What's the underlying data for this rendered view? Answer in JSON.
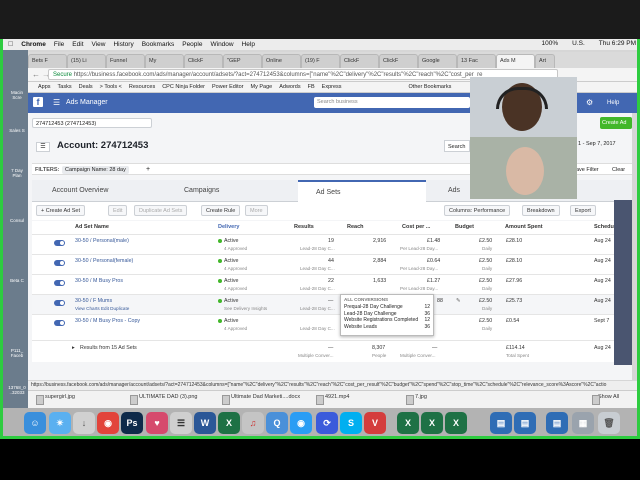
{
  "os": {
    "menu": [
      "Chrome",
      "File",
      "Edit",
      "View",
      "History",
      "Bookmarks",
      "People",
      "Window",
      "Help"
    ],
    "status_right": [
      "100%",
      "U.S.",
      "Thu 6:29 PM"
    ]
  },
  "browser": {
    "tabs": [
      "Bets F",
      "(15) Li",
      "Funnel",
      "My",
      "ClickF",
      "\"GEP",
      "Online",
      "(19) F",
      "ClickF",
      "ClickF",
      "Google",
      "13 Fac",
      "Ads M",
      "Art"
    ],
    "secure_label": "Secure",
    "url": "https://business.facebook.com/ads/manager/account/adsets/?act=274712453&columns=[\"name\"%2C\"delivery\"%2C\"results\"%2C\"reach\"%2C\"cost_per_re",
    "bookmarks": [
      "Apps",
      "Tasks",
      "Deals",
      "> Tools <",
      "Resources",
      "CPC Ninja Folder",
      "Power Editor",
      "My Page",
      "Adwords",
      "FB",
      "Express",
      "Other Bookmarks"
    ],
    "status_url": "https://business.facebook.com/ads/manager/account/adsets/?act=274712453&columns=[\"name\"%2C\"delivery\"%2C\"results\"%2C\"reach\"%2C\"cost_per_result\"%2C\"budget\"%2C\"spend\"%2C\"stop_time\"%2C\"schedule\"%2C\"relevance_score%3Ascore\"%2C\"actio"
  },
  "fb": {
    "app_title": "Ads Manager",
    "search_placeholder": "Search business",
    "account_selector": "274712453 (274712453)",
    "account_title": "Account: 274712453",
    "search_btn": "Search",
    "date_range": "1 - Sep 7, 2017",
    "filters_label": "FILTERS:",
    "filter_chip": "Campaign Name: 28 day",
    "filter_add": "+",
    "save_filter": "ave Filter",
    "clear": "Clear",
    "create_ad": "Create Ad",
    "help": "Help",
    "tabs": {
      "overview": "Account Overview",
      "campaigns": "Campaigns",
      "adsets": "Ad Sets",
      "ads": "Ads"
    },
    "toolbar": {
      "create": "Create Ad Set",
      "edit": "Edit",
      "duplicate": "Duplicate Ad Sets",
      "rule": "Create Rule",
      "more": "More",
      "columns": "Columns: Performance",
      "breakdown": "Breakdown",
      "export": "Export"
    },
    "headers": {
      "name": "Ad Set Name",
      "delivery": "Delivery",
      "results": "Results",
      "reach": "Reach",
      "cpr": "Cost per ...",
      "budget": "Budget",
      "spent": "Amount Spent",
      "schedule": "Schedu"
    },
    "rows": [
      {
        "name": "30-50 / Personal(male)",
        "delivery": "Active",
        "delivery_sub": "4 Approved",
        "results": "19",
        "results_sub": "Lead-28 Day C...",
        "reach": "2,916",
        "cpr": "£1.48",
        "cpr_sub": "Per Lead-28 Day...",
        "budget": "£2.50",
        "budget_sub": "Daily",
        "spent": "£28.10",
        "sched": "Aug 24"
      },
      {
        "name": "30-50 / Personal(female)",
        "delivery": "Active",
        "delivery_sub": "4 Approved",
        "results": "44",
        "results_sub": "Lead-28 Day C...",
        "reach": "2,884",
        "cpr": "£0.64",
        "cpr_sub": "Per Lead-28 Day...",
        "budget": "£2.50",
        "budget_sub": "Daily",
        "spent": "£28.10",
        "sched": "Aug 24"
      },
      {
        "name": "30-50 / M Busy Pros",
        "delivery": "Active",
        "delivery_sub": "4 Approved",
        "results": "22",
        "results_sub": "Lead-28 Day C...",
        "reach": "1,633",
        "cpr": "£1.27",
        "cpr_sub": "Per Lead-28 Day...",
        "budget": "£2.50",
        "budget_sub": "Daily",
        "spent": "£27.96",
        "sched": "Aug 24"
      },
      {
        "name": "30-50 / F Mums",
        "actions": "View Charts   Edit   Duplicate",
        "delivery": "Active",
        "delivery_sub": "See Delivery Insights",
        "results": "—",
        "results_sub": "Lead-28 Day C...",
        "reach": "",
        "cpr": "88",
        "cpr_sub": "",
        "budget": "£2.50",
        "budget_sub": "Daily",
        "spent": "£25.73",
        "sched": "Aug 24"
      },
      {
        "name": "30-50 / M Busy Pros - Copy",
        "delivery": "Active",
        "delivery_sub": "4 Approved",
        "results": "",
        "results_sub": "Lead-28 Day C...",
        "reach": "",
        "cpr": "",
        "cpr_sub": "",
        "budget": "£2.50",
        "budget_sub": "Daily",
        "spent": "£0.54",
        "sched": "Sept 7"
      }
    ],
    "totals": {
      "label": "Results from 15 Ad Sets",
      "results": "—",
      "results_sub": "Multiple Conver...",
      "reach": "8,307",
      "reach_sub": "People",
      "cpr": "—",
      "cpr_sub": "Multiple Conver...",
      "spent": "£114.14",
      "spent_sub": "Total Spent",
      "sched": "Aug 24"
    },
    "popover": {
      "title": "ALL CONVERSIONS",
      "items": [
        {
          "label": "Prequal-28 Day Challenge",
          "value": "12"
        },
        {
          "label": "Lead-28 Day Challenge",
          "value": "36"
        },
        {
          "label": "Website Registrations Completed",
          "value": "12"
        },
        {
          "label": "Website Leads",
          "value": "36"
        }
      ]
    }
  },
  "downloads": [
    "supergirl.jpg",
    "ULTIMATE DAD (3).png",
    "Ultimate Dad Marketi....docx",
    "4921.mp4",
    "7.jpg"
  ],
  "show_all": "Show All",
  "desktop_files": [
    "Macin Scre",
    "Sales S",
    "7 Day Plan",
    "Consul",
    "Beta C",
    "P111_ Faceb",
    "13768_0 ..32033"
  ]
}
